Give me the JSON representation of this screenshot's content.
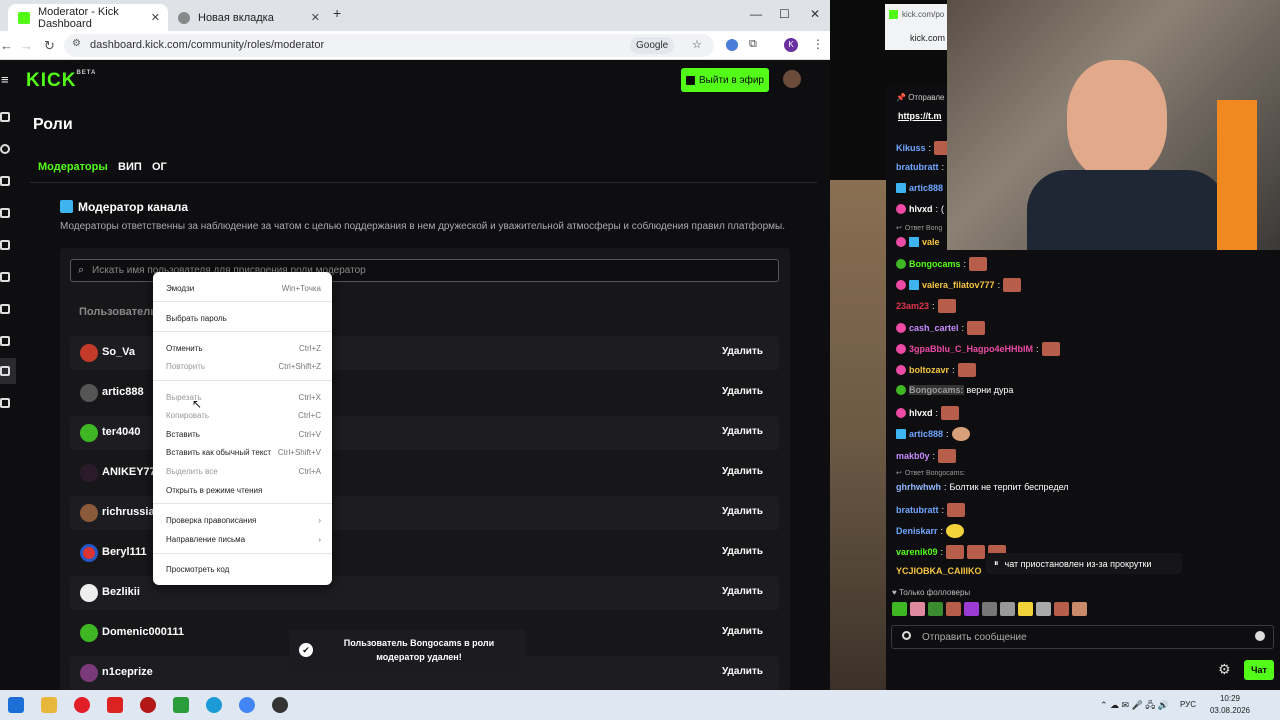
{
  "browser": {
    "tabs": [
      {
        "title": "Moderator - Kick Dashboard"
      },
      {
        "title": "Новая вкладка"
      }
    ],
    "url": "dashboard.kick.com/community/roles/moderator",
    "search_engine": "Google",
    "profile_letter": "K"
  },
  "kick": {
    "logo": "KICK",
    "logo_beta": "BETA",
    "go_live": "Выйти в эфир",
    "page_title": "Роли",
    "tabs": [
      "Модераторы",
      "ВИП",
      "ОГ"
    ],
    "section_title": "Модератор канала",
    "section_desc": "Модераторы ответственны за наблюдение за чатом с целью поддержания в нем дружеской и уважительной атмосферы и соблюдения правил платформы.",
    "search_placeholder": "Искать имя пользователя для присвоения роли модератор",
    "col_user": "Пользователь",
    "delete_label": "Удалить",
    "users": [
      "So_Va",
      "artic888",
      "ter4040",
      "ANIKEY77",
      "richrussia",
      "Beryl111",
      "Bezlikii",
      "Domenic000111",
      "n1ceprize"
    ]
  },
  "context_menu": {
    "items": [
      {
        "label": "Эмодзи",
        "shortcut": "Win+Точка"
      },
      {
        "label": "Выбрать пароль",
        "shortcut": ""
      },
      {
        "label": "Отменить",
        "shortcut": "Ctrl+Z"
      },
      {
        "label": "Повторить",
        "shortcut": "Ctrl+Shift+Z"
      },
      {
        "label": "Вырезать",
        "shortcut": "Ctrl+X"
      },
      {
        "label": "Копировать",
        "shortcut": "Ctrl+C"
      },
      {
        "label": "Вставить",
        "shortcut": "Ctrl+V"
      },
      {
        "label": "Вставить как обычный текст",
        "shortcut": "Ctrl+Shift+V"
      },
      {
        "label": "Выделить все",
        "shortcut": "Ctrl+A"
      },
      {
        "label": "Открыть в режиме чтения",
        "shortcut": ""
      },
      {
        "label": "Проверка правописания",
        "shortcut": "›"
      },
      {
        "label": "Направление письма",
        "shortcut": "›"
      },
      {
        "label": "Просмотреть код",
        "shortcut": ""
      }
    ]
  },
  "toast": {
    "text": "Пользователь Bongocams в роли модератор удален!"
  },
  "chat": {
    "popout_title": "kick.com/po",
    "popout_url": "kick.com",
    "pinned_label": "Отправле",
    "pinned_link": "https://t.m",
    "messages": [
      {
        "user": "Kikuss",
        "text": ""
      },
      {
        "user": "bratubratt",
        "text": ""
      },
      {
        "user": "artic888",
        "text": ""
      },
      {
        "user": "hlvxd",
        "text": "("
      },
      {
        "user": "Ответ Bong",
        "text": ""
      },
      {
        "user": "vale",
        "text": ""
      },
      {
        "user": "Bongocams",
        "text": ""
      },
      {
        "user": "valera_filatov777",
        "text": ""
      },
      {
        "user": "23am23",
        "text": ""
      },
      {
        "user": "cash_cartel",
        "text": ""
      },
      {
        "user": "3gpaBblu_C_Hagpo4eHHblM",
        "text": ""
      },
      {
        "user": "boltozavr",
        "text": ""
      },
      {
        "user": "Bongocams:",
        "text": "верни дура"
      },
      {
        "user": "hlvxd",
        "text": ""
      },
      {
        "user": "artic888",
        "text": ""
      },
      {
        "user": "makb0y",
        "text": ""
      },
      {
        "user": "Ответ Bongocams:",
        "text": ""
      },
      {
        "user": "ghrhwhwh",
        "text": "Болтик не терпит беспредел"
      },
      {
        "user": "bratubratt",
        "text": ""
      },
      {
        "user": "Deniskarr",
        "text": ""
      },
      {
        "user": "varenik09",
        "text": ""
      },
      {
        "user": "YCJIOBKA_CAIIIKO",
        "text": ""
      }
    ],
    "paused": "чат приостановлен из-за прокрутки",
    "followers_only": "Только фолловеры",
    "input_placeholder": "Отправить сообщение",
    "send": "Чат"
  },
  "taskbar": {
    "lang": "РУС",
    "time": "10:29",
    "date": "03.08.2026"
  }
}
